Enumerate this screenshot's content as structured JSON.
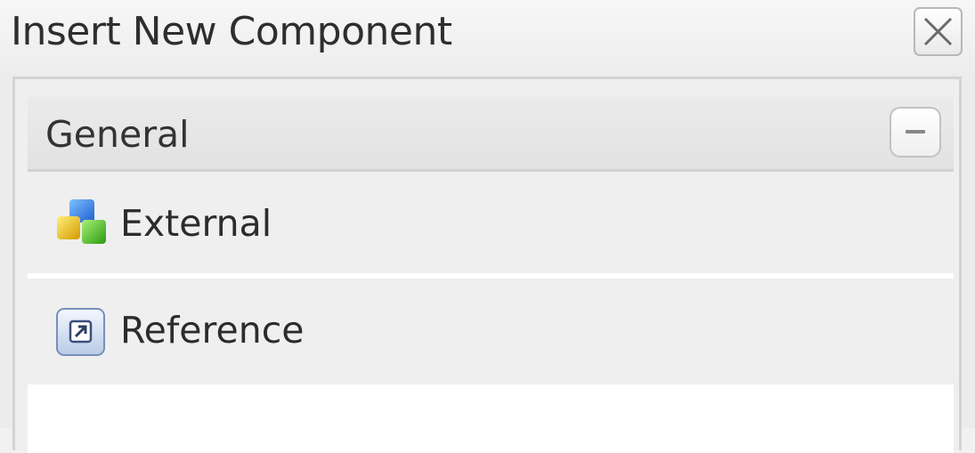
{
  "dialog": {
    "title": "Insert New Component",
    "close_icon": "close-icon"
  },
  "panel": {
    "title": "General",
    "collapse_icon": "minus-icon",
    "items": [
      {
        "label": "External",
        "icon": "cubes-icon"
      },
      {
        "label": "Reference",
        "icon": "reference-arrow-icon"
      }
    ]
  }
}
